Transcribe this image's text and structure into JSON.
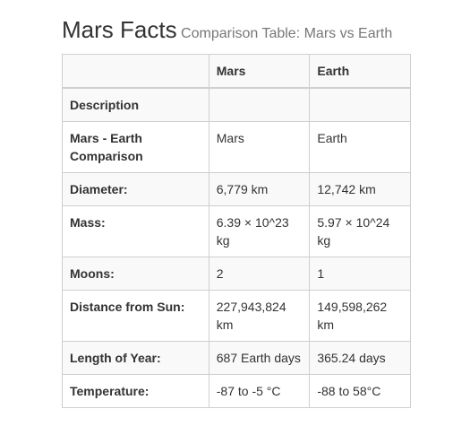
{
  "header": {
    "title": "Mars Facts",
    "subtitle": "Comparison Table: Mars vs Earth"
  },
  "table": {
    "columns": [
      "",
      "Mars",
      "Earth"
    ],
    "rows": [
      {
        "label": "Description",
        "mars": "",
        "earth": ""
      },
      {
        "label": "Mars - Earth Comparison",
        "mars": "Mars",
        "earth": "Earth"
      },
      {
        "label": "Diameter:",
        "mars": "6,779 km",
        "earth": "12,742 km"
      },
      {
        "label": "Mass:",
        "mars": "6.39 × 10^23 kg",
        "earth": "5.97 × 10^24 kg"
      },
      {
        "label": "Moons:",
        "mars": "2",
        "earth": "1"
      },
      {
        "label": "Distance from Sun:",
        "mars": "227,943,824 km",
        "earth": "149,598,262 km"
      },
      {
        "label": "Length of Year:",
        "mars": "687 Earth days",
        "earth": "365.24 days"
      },
      {
        "label": "Temperature:",
        "mars": "-87 to -5 °C",
        "earth": "-88 to 58°C"
      }
    ]
  }
}
